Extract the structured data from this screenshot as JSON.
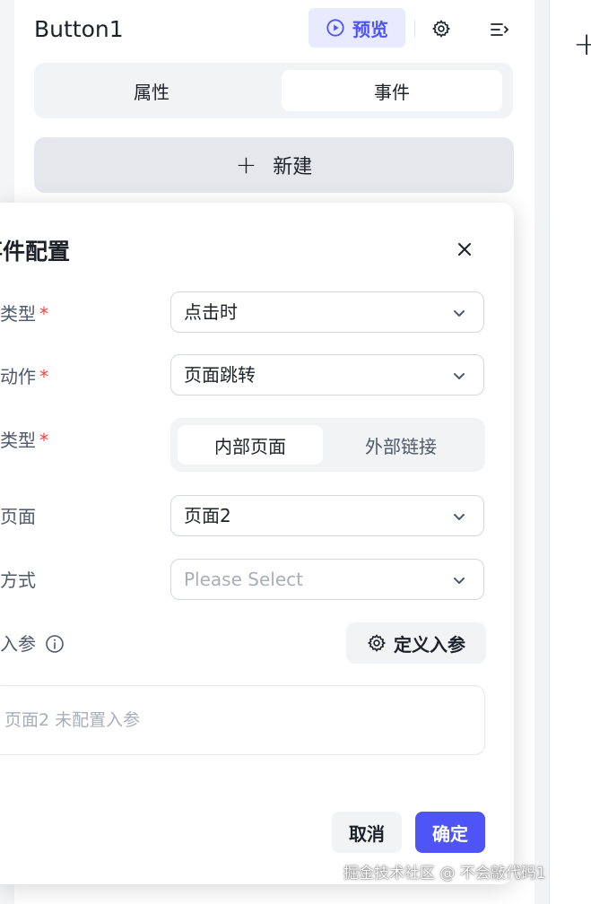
{
  "header": {
    "component_name": "Button1",
    "preview_label": "预览",
    "preview_icon": "play-circle-icon",
    "settings_icon": "gear-icon",
    "menu_icon": "collapse-menu-icon"
  },
  "tabs": [
    {
      "label": "属性",
      "active": false
    },
    {
      "label": "事件",
      "active": true
    }
  ],
  "new_button": {
    "label": "新建",
    "icon": "plus-icon"
  },
  "right_toolbar": {
    "add_icon": "+"
  },
  "modal": {
    "title": "事件配置",
    "fields": {
      "event_type": {
        "label": "件类型",
        "required": true,
        "value": "点击时"
      },
      "action": {
        "label": "行动作",
        "required": true,
        "value": "页面跳转"
      },
      "page_type": {
        "label": "面类型",
        "required": true,
        "options": [
          "内部页面",
          "外部链接"
        ],
        "selected": "内部页面"
      },
      "select_page": {
        "label": "择页面",
        "value": "页面2"
      },
      "jump_mode": {
        "label": "转方式",
        "value": "",
        "placeholder": "Please Select"
      },
      "page_params": {
        "label": "面入参",
        "define_button": "定义入参",
        "empty_text": "页面2 未配置入参"
      }
    },
    "cancel_label": "取消",
    "ok_label": "确定"
  },
  "watermark": "掘金技术社区 @ 不会敲代码1",
  "colors": {
    "primary": "#4e54f6",
    "required": "#f53f3f",
    "placeholder": "#a9aeb8"
  }
}
